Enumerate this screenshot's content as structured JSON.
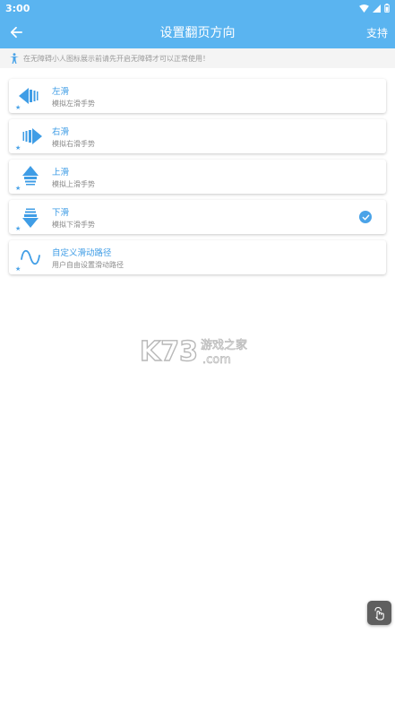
{
  "status_bar": {
    "time": "3:00"
  },
  "header": {
    "title": "设置翻页方向",
    "support_label": "支持"
  },
  "notice": {
    "text": "在无障碍小人图标展示前请先开启无障碍才可以正常使用！"
  },
  "options": [
    {
      "title": "左滑",
      "subtitle": "模拟左滑手势",
      "icon": "arrow-left-icon",
      "selected": false
    },
    {
      "title": "右滑",
      "subtitle": "模拟右滑手势",
      "icon": "arrow-right-icon",
      "selected": false
    },
    {
      "title": "上滑",
      "subtitle": "模拟上滑手势",
      "icon": "arrow-up-icon",
      "selected": false
    },
    {
      "title": "下滑",
      "subtitle": "模拟下滑手势",
      "icon": "arrow-down-icon",
      "selected": true
    },
    {
      "title": "自定义滑动路径",
      "subtitle": "用户自由设置滑动路径",
      "icon": "wave-icon",
      "selected": false
    }
  ],
  "watermark": {
    "brand": "K73",
    "cn": "游戏之家",
    "domain": ".com"
  },
  "colors": {
    "primary": "#5ab4f0",
    "accent": "#4aa3e8",
    "text_muted": "#8a8a8a",
    "notice_bg": "#f4f4f4"
  }
}
